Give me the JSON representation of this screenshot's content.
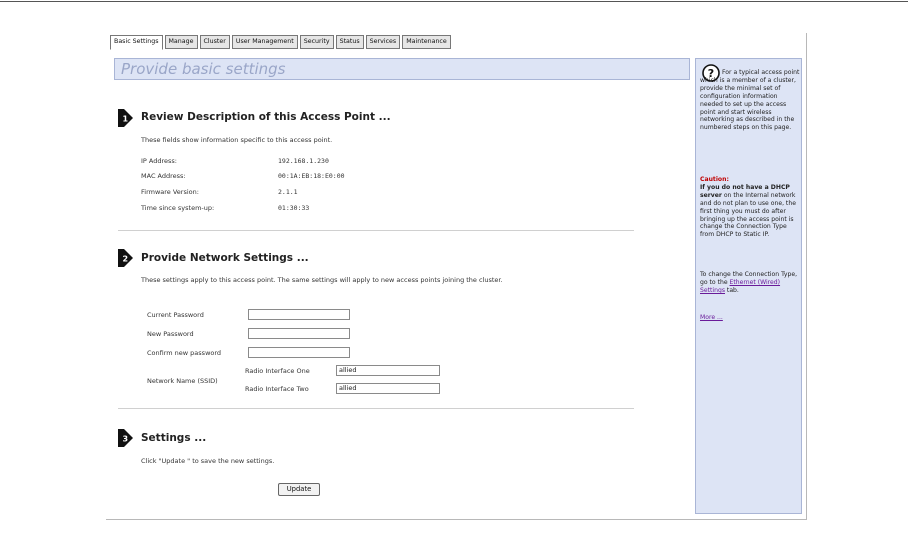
{
  "tabs": [
    "Basic Settings",
    "Manage",
    "Cluster",
    "User Management",
    "Security",
    "Status",
    "Services",
    "Maintenance"
  ],
  "page_title": "Provide basic settings",
  "section1": {
    "title": "Review Description of this Access Point ...",
    "description": "These fields show information specific to this access point.",
    "labels": {
      "ip": "IP Address:",
      "mac": "MAC Address:",
      "firmware": "Firmware Version:",
      "uptime": "Time since system-up:"
    },
    "values": {
      "ip": "192.168.1.230",
      "mac": "00:1A:EB:18:E0:00",
      "firmware": "2.1.1",
      "uptime": "01:30:33"
    }
  },
  "section2": {
    "title": "Provide Network Settings ...",
    "description": "These settings apply to this access point. The same settings will apply to new access points joining the cluster.",
    "current_password_label": "Current Password",
    "new_password_label": "New Password",
    "confirm_password_label": "Confirm new password",
    "ssid_label": "Network Name (SSID)",
    "radio_one_label": "Radio Interface One",
    "radio_two_label": "Radio Interface Two",
    "radio_one_value": "allied",
    "radio_two_value": "allied"
  },
  "section3": {
    "title": "Settings ...",
    "description": "Click  \"Update \" to save the new settings.",
    "update_label": "Update"
  },
  "help": {
    "intro": "For a typical access point which is a member of a cluster, provide the minimal set of configuration information needed to set up the access point and start wireless networking as described in the numbered steps on this page.",
    "caution_title": "Caution:",
    "caution_bold": "If you do not have a DHCP server",
    "caution_text": " on the Internal network and do not plan to use one, the first thing you must do after bringing up the access point is change the Connection Type from DHCP to Static IP.",
    "change_text": "To change the Connection Type, go to the ",
    "ethernet_link": "Ethernet (Wired) Settings",
    "tab_text": " tab.",
    "more_link": "More ..."
  },
  "step_numbers": [
    "1",
    "2",
    "3"
  ]
}
